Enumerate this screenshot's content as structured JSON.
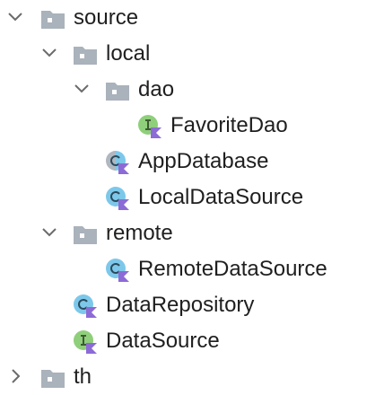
{
  "tree": {
    "rows": [
      {
        "label": "source",
        "icon": "folder-icon",
        "expanded": true
      },
      {
        "label": "local",
        "icon": "folder-icon",
        "expanded": true
      },
      {
        "label": "dao",
        "icon": "folder-icon",
        "expanded": true
      },
      {
        "label": "FavoriteDao",
        "icon": "kotlin-interface-icon"
      },
      {
        "label": "AppDatabase",
        "icon": "kotlin-abstract-class-icon"
      },
      {
        "label": "LocalDataSource",
        "icon": "kotlin-class-icon"
      },
      {
        "label": "remote",
        "icon": "folder-icon",
        "expanded": true
      },
      {
        "label": "RemoteDataSource",
        "icon": "kotlin-class-icon"
      },
      {
        "label": "DataRepository",
        "icon": "kotlin-class-icon"
      },
      {
        "label": "DataSource",
        "icon": "kotlin-interface-icon"
      },
      {
        "label": "th",
        "icon": "folder-icon",
        "expanded": false
      }
    ]
  },
  "colors": {
    "folder": "#aab2bb",
    "class": "#7dc8ea",
    "interface": "#8fcf7b",
    "kotlin": "#8c6bd6",
    "chevron": "#6b6b6b"
  }
}
